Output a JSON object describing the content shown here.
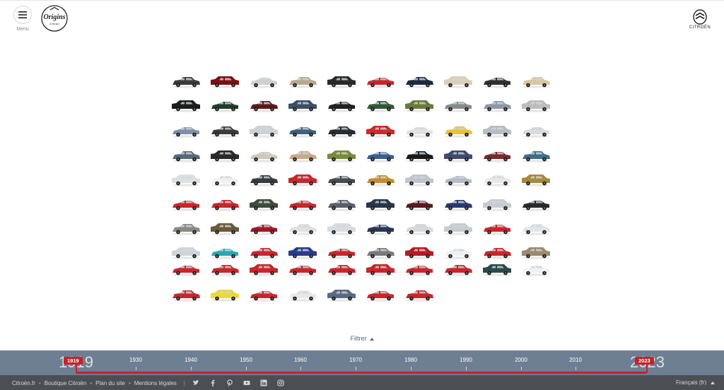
{
  "header": {
    "menu_label": "Menu",
    "origins_logo_text": "Origins",
    "brand_name": "CITROËN"
  },
  "filter": {
    "label": "Filtrer"
  },
  "timeline": {
    "start_year": "1919",
    "end_year": "2023",
    "ghost_start": "1919",
    "ghost_end": "2023",
    "decades": [
      "1930",
      "1940",
      "1950",
      "1960",
      "1970",
      "1980",
      "1990",
      "2000",
      "2010"
    ]
  },
  "footer": {
    "links": [
      "Citroën.fr",
      "Boutique Citroën",
      "Plan du site",
      "Mentions légales"
    ],
    "social": [
      "twitter-icon",
      "facebook-icon",
      "pinterest-icon",
      "youtube-icon",
      "linkedin-icon",
      "instagram-icon"
    ],
    "language": "Français (fr)"
  },
  "colors": {
    "accent": "#c8202b",
    "timeline_bg": "#6e7f93",
    "footer_bg": "#4b4f53"
  },
  "cars": [
    [
      "#3a3a3a",
      "#7a1014",
      "#cfcfcf",
      "#b8a890",
      "#2a2a2a",
      "#c8262b",
      "#1e2a40",
      "#d8d0b8",
      "#2f2f2f",
      "#d6c8a0"
    ],
    [
      "#1c1c1c",
      "#1f3d2a",
      "#5a1a1a",
      "#3c4e66",
      "#202020",
      "#2f5a3a",
      "#6b7a3a",
      "#8a8a8a",
      "#8f98a8",
      "#bdbdbd"
    ],
    [
      "#7f8fa6",
      "#3a3a3a",
      "#d0d0d0",
      "#3f5f7a",
      "#2a2a30",
      "#cc2a2a",
      "#e2e2e2",
      "#e8c23a",
      "#b8bcc4",
      "#dcdcdc"
    ],
    [
      "#586878",
      "#2a2a2a",
      "#d0c8b8",
      "#c8a888",
      "#7a8a3a",
      "#3a5f8f",
      "#1a1a1a",
      "#3e4a70",
      "#7a2a2a",
      "#3e6d8a"
    ],
    [
      "#e0e0e0",
      "#f0f0f0",
      "#3a3a3a",
      "#c8262b",
      "#4a4a4a",
      "#c88a2a",
      "#c0c4cc",
      "#b8bcc4",
      "#e8e8e8",
      "#a68a3a"
    ],
    [
      "#c8262b",
      "#c8262b",
      "#3e4a3a",
      "#c8262b",
      "#58606a",
      "#2a3448",
      "#5a1a20",
      "#2a3a70",
      "#c8ccd2",
      "#2a2a2a"
    ],
    [
      "#8a8a80",
      "#6a5a3a",
      "#a01a22",
      "#e0e0e0",
      "#d8dce0",
      "#2a3858",
      "#d8d8d8",
      "#c8ccd2",
      "#c8262b",
      "#e4e4e4"
    ],
    [
      "#d0d4d8",
      "#2aa8b0",
      "#c8262b",
      "#2a3a8a",
      "#c8262b",
      "#7a7a7a",
      "#b81a22",
      "#f0f0f0",
      "#c8262b",
      "#9a8a70"
    ],
    [
      "#c8262b",
      "#c8262b",
      "#c8262b",
      "#c8262b",
      "#c8262b",
      "#c8262b",
      "#c8262b",
      "#c8262b",
      "#2a4a4a",
      "#f0f0f0"
    ],
    [
      "#c8262b",
      "#e8d83a",
      "#c8262b",
      "#e8e8e8",
      "#5a6a80",
      "#c8262b",
      "#c8262b"
    ]
  ]
}
